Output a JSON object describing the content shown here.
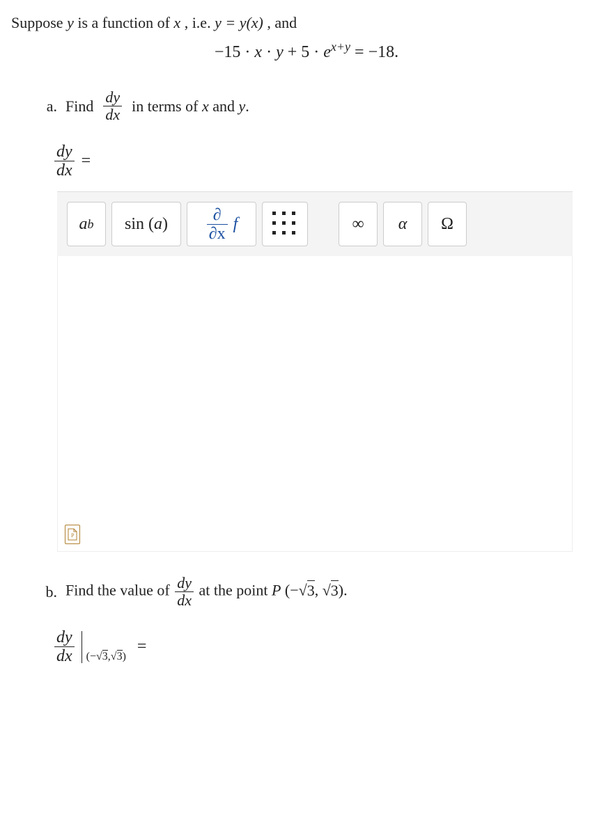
{
  "prompt": {
    "leadA": "Suppose ",
    "leadB": " is a function of ",
    "leadC": ", i.e. ",
    "leadD": ", and",
    "y": "y",
    "x": "x",
    "yeq": "y = y(x)"
  },
  "equation": {
    "lhs_a": "−15 · ",
    "lhs_b": " · ",
    "lhs_c": " + 5 · ",
    "exp_pre": "e",
    "exp_sup": "x+y",
    "rhs": " = −18."
  },
  "partA": {
    "label": "a.",
    "word": "Find",
    "frac_num": "dy",
    "frac_den": "dx",
    "tail1": " in terms of ",
    "tail2": " and ",
    "period": "."
  },
  "answerA": {
    "frac_num": "dy",
    "frac_den": "dx",
    "equals": "="
  },
  "toolbar": {
    "btn1_base": "a",
    "btn1_sup": "b",
    "btn2_fn": "sin",
    "btn2_arg": "a",
    "btn3_num": "∂",
    "btn3_den": "∂x",
    "btn3_f": "f",
    "btn5": "∞",
    "btn6": "α",
    "btn7": "Ω"
  },
  "partB": {
    "label": "b.",
    "lead": "Find the value of ",
    "frac_num": "dy",
    "frac_den": "dx",
    "mid": " at the point ",
    "pt_label": "P",
    "pt_open": "(−",
    "pt_s1": "3",
    "pt_comma": ", ",
    "pt_s2": "3",
    "pt_close": ").",
    "sqrt": "√"
  },
  "answerB": {
    "frac_num": "dy",
    "frac_den": "dx",
    "sub_open": "(−",
    "sub_s1": "3",
    "sub_comma": ",",
    "sub_s2": "3",
    "sub_close": ")",
    "sqrt": "√",
    "equals": "="
  }
}
